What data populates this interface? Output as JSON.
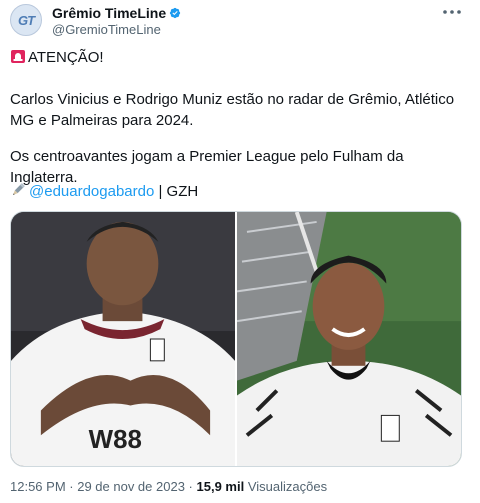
{
  "author": {
    "avatar_text": "GT",
    "display_name": "Grêmio TimeLine",
    "handle": "@GremioTimeLine"
  },
  "tweet": {
    "line1": "ATENÇÃO!",
    "line2": "Carlos Vinicius e Rodrigo Muniz estão no radar de Grêmio, Atlético MG e Palmeiras para 2024.",
    "line3": "Os centroavantes jogam a Premier League pelo Fulham da Inglaterra.",
    "mention": "@eduardogabardo",
    "source": " | GZH"
  },
  "meta": {
    "time": "12:56 PM",
    "sep1": " · ",
    "date": "29 de nov de 2023",
    "sep2": " · ",
    "views_count": "15,9 mil",
    "views_label": " Visualizações"
  },
  "colors": {
    "link": "#1d9bf0",
    "verified": "#1d9bf0",
    "muted": "#536471"
  },
  "icons": [
    "verified-icon",
    "more-icon",
    "siren-icon",
    "pencil-icon"
  ]
}
